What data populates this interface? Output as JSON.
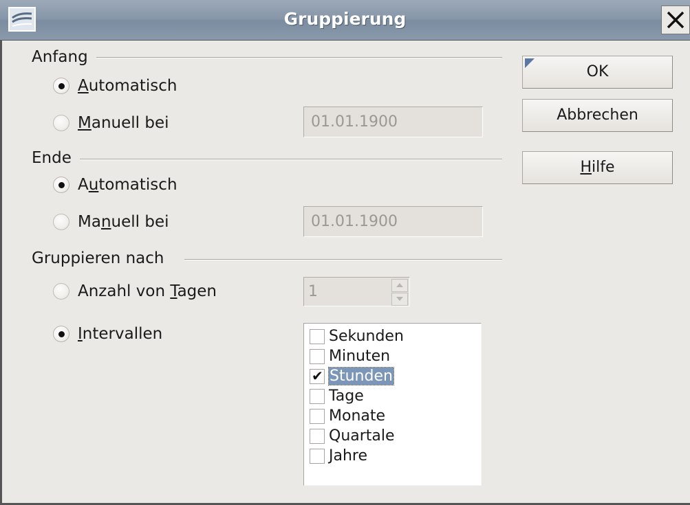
{
  "window": {
    "title": "Gruppierung"
  },
  "start": {
    "label": "Anfang",
    "automatic": {
      "pre": "",
      "key": "A",
      "post": "utomatisch",
      "selected": true
    },
    "manual": {
      "pre": "",
      "key": "M",
      "post": "anuell bei",
      "selected": false,
      "value": "01.01.1900"
    }
  },
  "end": {
    "label": "Ende",
    "automatic": {
      "pre": "A",
      "key": "u",
      "post": "tomatisch",
      "selected": true
    },
    "manual": {
      "pre": "Ma",
      "key": "n",
      "post": "uell bei",
      "selected": false,
      "value": "01.01.1900"
    }
  },
  "group_by": {
    "label": "Gruppieren nach",
    "days": {
      "pre": "Anzahl von ",
      "key": "T",
      "post": "agen",
      "selected": false,
      "value": "1"
    },
    "intervals": {
      "pre": "",
      "key": "I",
      "post": "ntervallen",
      "selected": true
    },
    "interval_items": [
      {
        "label": "Sekunden",
        "checked": false
      },
      {
        "label": "Minuten",
        "checked": false
      },
      {
        "label": "Stunden",
        "checked": true
      },
      {
        "label": "Tage",
        "checked": false
      },
      {
        "label": "Monate",
        "checked": false
      },
      {
        "label": "Quartale",
        "checked": false
      },
      {
        "label": "Jahre",
        "checked": false
      }
    ]
  },
  "buttons": {
    "ok": "OK",
    "cancel": "Abbrechen",
    "help": {
      "pre": "",
      "key": "H",
      "post": "ilfe"
    }
  },
  "colors": {
    "titlebar": "#8696a8",
    "selection": "#7b96b8",
    "background": "#ebe9e5"
  }
}
